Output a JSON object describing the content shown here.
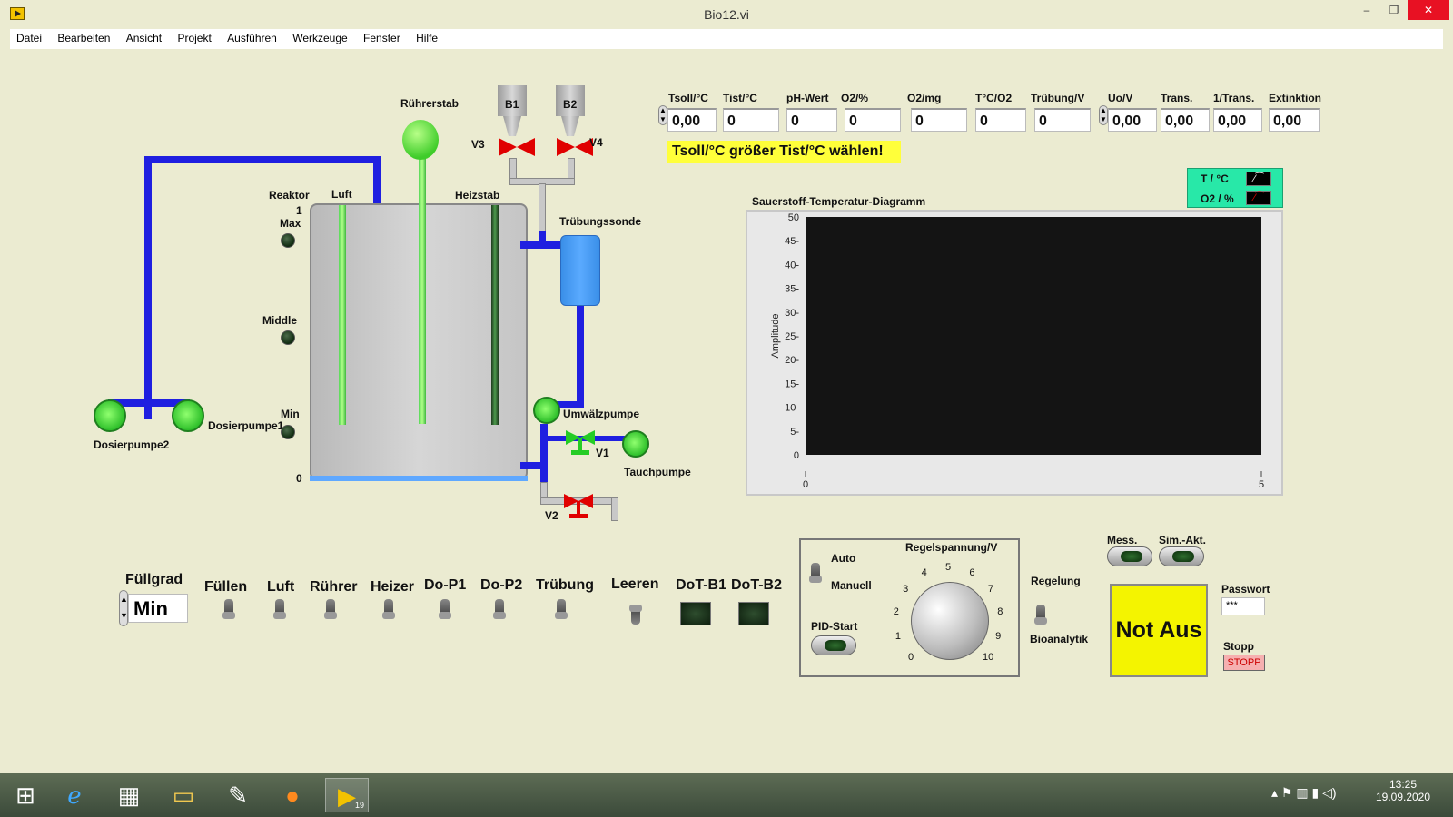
{
  "window": {
    "title": "Bio12.vi",
    "min": "–",
    "max": "❐",
    "close": "✕",
    "close_color": "#e81123"
  },
  "menu": [
    "Datei",
    "Bearbeiten",
    "Ansicht",
    "Projekt",
    "Ausführen",
    "Werkzeuge",
    "Fenster",
    "Hilfe"
  ],
  "diagram": {
    "reaktor": "Reaktor",
    "luft": "Luft",
    "heizstab": "Heizstab",
    "ruehrerstab": "Rührerstab",
    "level_1": "1",
    "level_max": "Max",
    "level_middle": "Middle",
    "level_min": "Min",
    "level_0": "0",
    "b1": "B1",
    "b2": "B2",
    "v1": "V1",
    "v2": "V2",
    "v3": "V3",
    "v4": "V4",
    "truebungssonde": "Trübungssonde",
    "umwaelzpumpe": "Umwälzpumpe",
    "tauchpumpe": "Tauchpumpe",
    "dosierpumpe1": "Dosierpumpe1",
    "dosierpumpe2": "Dosierpumpe2"
  },
  "readouts": [
    {
      "label": "Tsoll/°C",
      "value": "0,00"
    },
    {
      "label": "Tist/°C",
      "value": "0"
    },
    {
      "label": "pH-Wert",
      "value": "0"
    },
    {
      "label": "O2/%",
      "value": "0"
    },
    {
      "label": "O2/mg",
      "value": "0"
    },
    {
      "label": "T°C/O2",
      "value": "0"
    },
    {
      "label": "Trübung/V",
      "value": "0"
    },
    {
      "label": "Uo/V",
      "value": "0,00"
    },
    {
      "label": "Trans.",
      "value": "0,00"
    },
    {
      "label": "1/Trans.",
      "value": "0,00"
    },
    {
      "label": "Extinktion",
      "value": "0,00"
    }
  ],
  "warning": "Tsoll/°C größer Tist/°C wählen!",
  "legend": {
    "t": "T / °C",
    "o2": "O2 / %"
  },
  "chart_data": {
    "type": "line",
    "title": "Sauerstoff-Temperatur-Diagramm",
    "xlabel": "",
    "ylabel": "Amplitude",
    "xlim": [
      0,
      5
    ],
    "ylim": [
      0,
      50
    ],
    "x_ticks": [
      "0",
      "5"
    ],
    "y_ticks": [
      "0",
      "5-",
      "10-",
      "15-",
      "20-",
      "25-",
      "30-",
      "35-",
      "40-",
      "45-",
      "50"
    ],
    "series": [
      {
        "name": "T / °C",
        "values": []
      },
      {
        "name": "O2 / %",
        "values": []
      }
    ],
    "legend_position": "top-right",
    "plot_background": "#141414"
  },
  "controls": {
    "fuellgrad_label": "Füllgrad",
    "fuellgrad_value": "Min",
    "fuellen": "Füllen",
    "luft": "Luft",
    "ruehrer": "Rührer",
    "heizer": "Heizer",
    "dop1": "Do-P1",
    "dop2": "Do-P2",
    "truebung": "Trübung",
    "leeren": "Leeren",
    "dotb1": "DoT-B1",
    "dotb2": "DoT-B2"
  },
  "regel": {
    "auto": "Auto",
    "manuell": "Manuell",
    "regelspannung": "Regelspannung/V",
    "pid_start": "PID-Start",
    "regelung": "Regelung",
    "bioanalytik": "Bioanalytik",
    "dial": [
      "0",
      "1",
      "2",
      "3",
      "4",
      "5",
      "6",
      "7",
      "8",
      "9",
      "10"
    ]
  },
  "right": {
    "mess": "Mess.",
    "sim": "Sim.-Akt.",
    "not_aus": "Not Aus",
    "passwort": "Passwort",
    "passwort_value": "***",
    "stopp": "Stopp",
    "stopp_btn": "STOPP"
  },
  "taskbar": {
    "time": "13:25",
    "date": "19.09.2020",
    "labview_badge": "19"
  }
}
